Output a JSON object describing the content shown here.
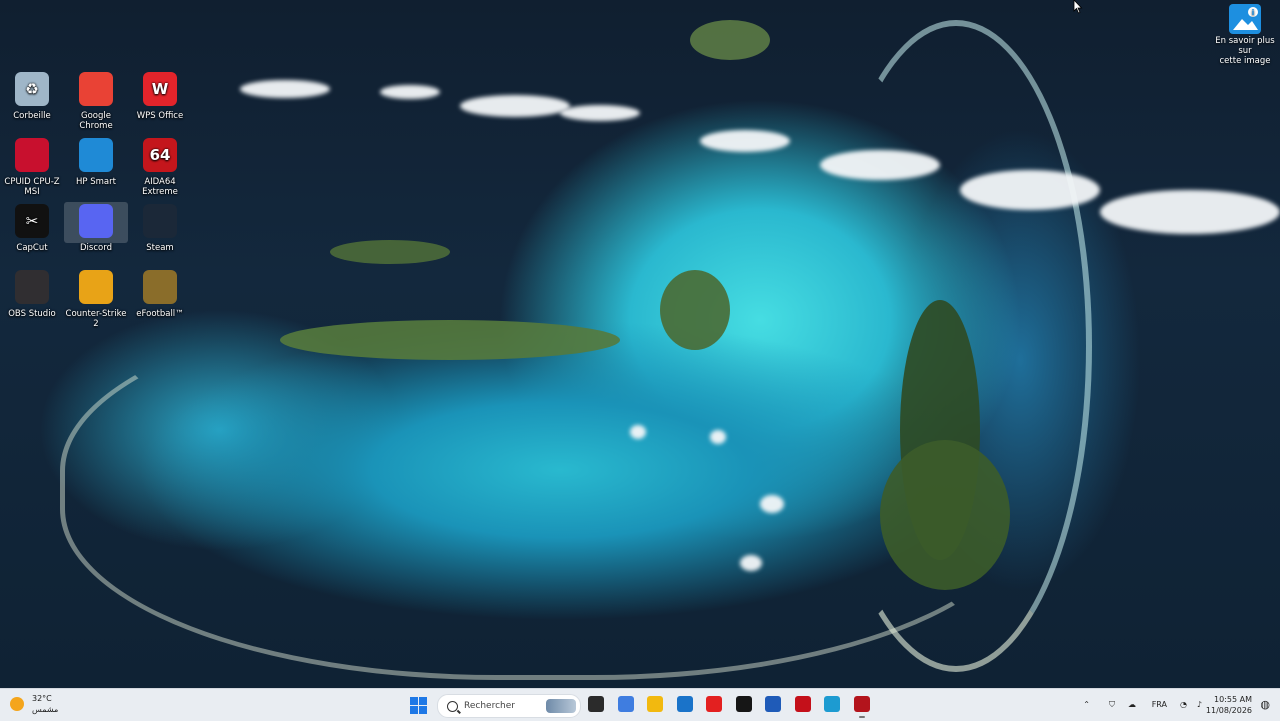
{
  "desktop": {
    "icons": [
      {
        "label": "Corbeille",
        "icon": "recycle-bin-icon",
        "color": "#9fb6c8"
      },
      {
        "label": "Google Chrome",
        "icon": "chrome-icon",
        "color": "#e94235"
      },
      {
        "label": "WPS Office",
        "icon": "wps-office-icon",
        "color": "#e3242b"
      },
      {
        "label": "CPUID CPU-Z MSI",
        "icon": "cpuz-icon",
        "color": "#c8102e"
      },
      {
        "label": "HP Smart",
        "icon": "hp-smart-icon",
        "color": "#1f8ad6"
      },
      {
        "label": "AIDA64 Extreme",
        "icon": "aida64-icon",
        "color": "#c4161c"
      },
      {
        "label": "CapCut",
        "icon": "capcut-icon",
        "color": "#111111"
      },
      {
        "label": "Discord",
        "icon": "discord-icon",
        "color": "#5865f2"
      },
      {
        "label": "Steam",
        "icon": "steam-icon",
        "color": "#1b2838"
      },
      {
        "label": "OBS Studio",
        "icon": "obs-icon",
        "color": "#302e31"
      },
      {
        "label": "Counter-Strike 2",
        "icon": "counter-strike-icon",
        "color": "#e8a317"
      },
      {
        "label": "eFootball™",
        "icon": "efootball-icon",
        "color": "#8a6d2a"
      }
    ],
    "glyphs": [
      "♻",
      "",
      "W",
      "",
      "",
      "64",
      "✂",
      "",
      "",
      "",
      "",
      ""
    ],
    "spotlight": {
      "line1": "En savoir plus sur",
      "line2": "cette image"
    }
  },
  "taskbar": {
    "weather": {
      "temp": "32°C",
      "condition": "مشمس"
    },
    "search_placeholder": "Rechercher",
    "apps": [
      {
        "name": "task-view-icon",
        "color": "#2b2b2b"
      },
      {
        "name": "copilot-icon",
        "color": "#3f7de0"
      },
      {
        "name": "file-explorer-icon",
        "color": "#f2b90f"
      },
      {
        "name": "microsoft-store-icon",
        "color": "#1a73c9"
      },
      {
        "name": "youtube-icon",
        "color": "#e32020"
      },
      {
        "name": "wps-writer-icon",
        "color": "#161616"
      },
      {
        "name": "word-icon",
        "color": "#1f5bb8"
      },
      {
        "name": "netflix-icon",
        "color": "#c4101a"
      },
      {
        "name": "edge-icon",
        "color": "#1d9bd1"
      },
      {
        "name": "aida64-taskbar-icon",
        "color": "#b3141c"
      }
    ],
    "tray": {
      "language": "FRA",
      "time": "10:55 AM",
      "date": "11/08/2026"
    }
  }
}
